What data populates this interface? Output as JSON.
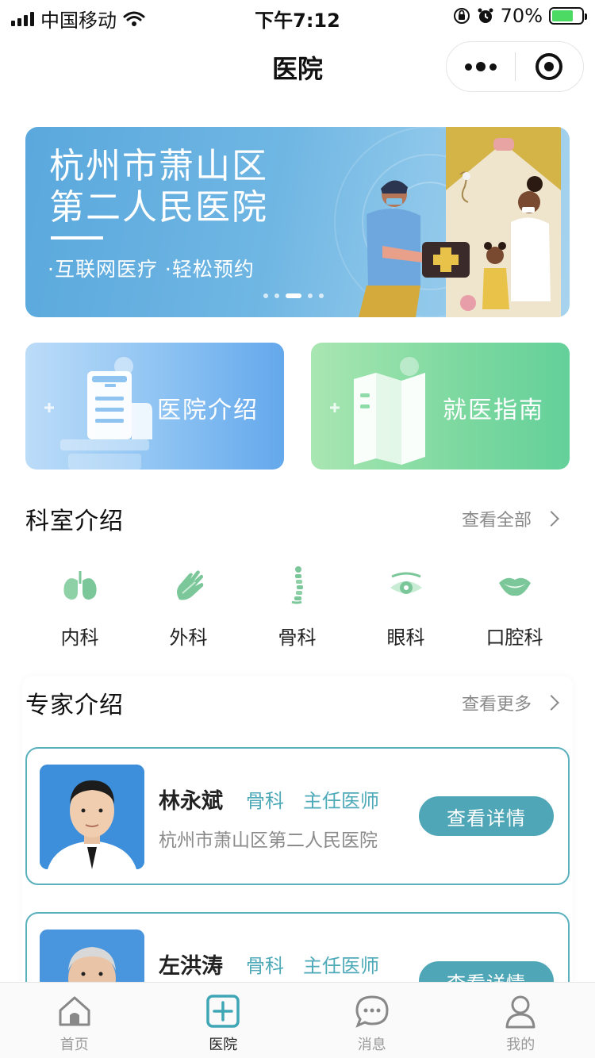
{
  "status_bar": {
    "carrier": "中国移动",
    "time": "下午7:12",
    "battery": "70%"
  },
  "nav": {
    "title": "医院"
  },
  "banner": {
    "title_line1": "杭州市萧山区",
    "title_line2": "第二人民医院",
    "subtitle": "·互联网医疗  ·轻松预约"
  },
  "entries": {
    "intro_label": "医院介绍",
    "guide_label": "就医指南"
  },
  "departments": {
    "title": "科室介绍",
    "more": "查看全部",
    "items": [
      {
        "label": "内科",
        "icon": "lungs-icon"
      },
      {
        "label": "外科",
        "icon": "hand-icon"
      },
      {
        "label": "骨科",
        "icon": "spine-icon"
      },
      {
        "label": "眼科",
        "icon": "eye-icon"
      },
      {
        "label": "口腔科",
        "icon": "mouth-icon"
      }
    ]
  },
  "experts": {
    "title": "专家介绍",
    "more": "查看更多",
    "doctors": [
      {
        "name": "林永斌",
        "dept": "骨科",
        "title": "主任医师",
        "hospital": "杭州市萧山区第二人民医院",
        "button": "查看详情"
      },
      {
        "name": "左洪涛",
        "dept": "骨科",
        "title": "主任医师",
        "hospital": "",
        "button": "查看详情"
      }
    ]
  },
  "tabbar": {
    "items": [
      {
        "label": "首页",
        "icon": "home-icon"
      },
      {
        "label": "医院",
        "icon": "hospital-plus-icon"
      },
      {
        "label": "消息",
        "icon": "chat-icon"
      },
      {
        "label": "我的",
        "icon": "user-icon"
      }
    ],
    "active": "医院"
  },
  "colors": {
    "accent": "#4ea6b6",
    "card_border": "#5ab0bd",
    "dept_icon": "#7cc79a"
  }
}
